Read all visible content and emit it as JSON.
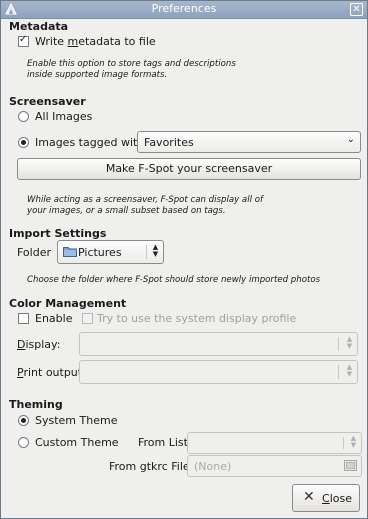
{
  "window": {
    "title": "Preferences"
  },
  "metadata": {
    "heading": "Metadata",
    "write_label_pre": "Write ",
    "write_label_u": "m",
    "write_label_post": "etadata to file",
    "write_checked": true,
    "description": "Enable this option to store tags and descriptions inside supported image formats."
  },
  "screensaver": {
    "heading": "Screensaver",
    "all_images_label": "All Images",
    "tagged_label": "Images tagged with:",
    "tag_value": "Favorites",
    "make_button": "Make F-Spot your screensaver",
    "description": "While acting as a screensaver, F-Spot can display all of your images, or a small subset based on tags."
  },
  "import": {
    "heading": "Import Settings",
    "folder_label": "Folder",
    "folder_value": "Pictures",
    "description": "Choose the folder where F-Spot should store newly imported photos"
  },
  "color": {
    "heading": "Color Management",
    "enable_label": "Enable",
    "system_profile_label": "Try to use the system display profile",
    "display_label_u": "D",
    "display_label_rest": "isplay:",
    "print_label_u": "P",
    "print_label_rest": "rint output:"
  },
  "theming": {
    "heading": "Theming",
    "system_label": "System Theme",
    "custom_label": "Custom Theme",
    "from_list_label": "From List:",
    "gtkrc_label": "From gtkrc File:",
    "gtkrc_value": "(None)"
  },
  "footer": {
    "close_u": "C",
    "close_rest": "lose"
  }
}
